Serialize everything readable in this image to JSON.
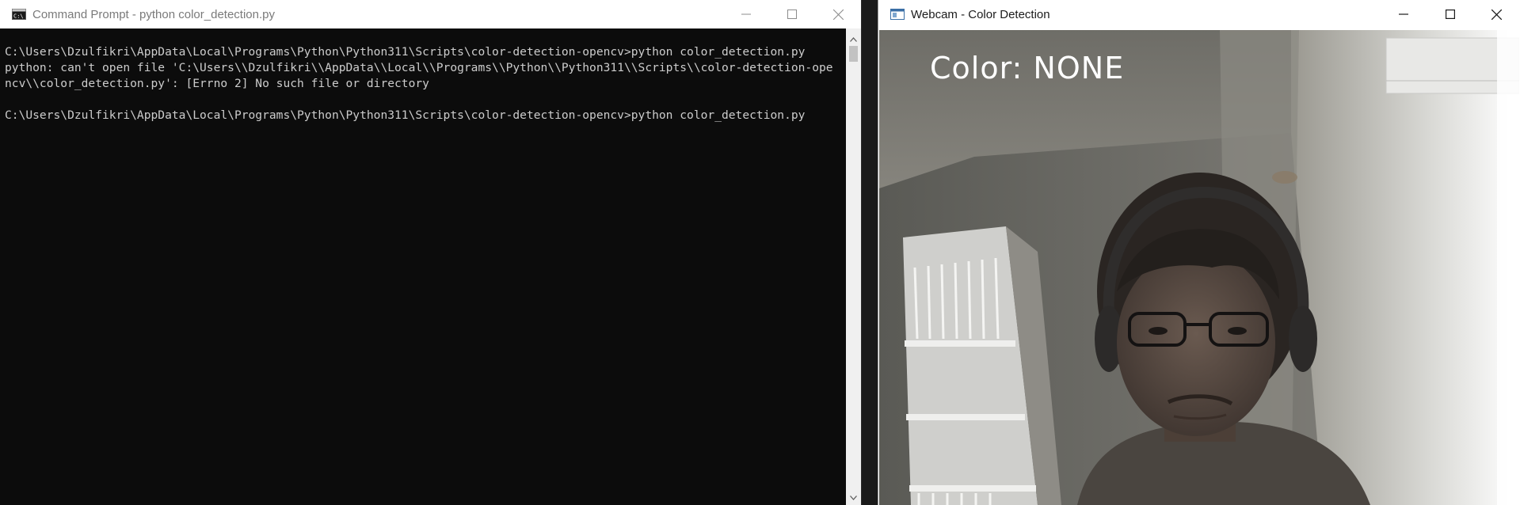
{
  "cmd": {
    "title": "Command Prompt - python  color_detection.py",
    "icon": "cmd-icon",
    "lines": [
      "C:\\Users\\Dzulfikri\\AppData\\Local\\Programs\\Python\\Python311\\Scripts\\color-detection-opencv>python color_detection.py",
      "python: can't open file 'C:\\Users\\\\Dzulfikri\\\\AppData\\\\Local\\\\Programs\\\\Python\\\\Python311\\\\Scripts\\\\color-detection-ope",
      "ncv\\\\color_detection.py': [Errno 2] No such file or directory",
      "",
      "C:\\Users\\Dzulfikri\\AppData\\Local\\Programs\\Python\\Python311\\Scripts\\color-detection-opencv>python color_detection.py"
    ]
  },
  "webcam": {
    "title": "Webcam - Color Detection",
    "icon": "webcam-window-icon",
    "overlay_text": "Color: NONE"
  },
  "window_controls": {
    "minimize": "minimize-icon",
    "maximize": "maximize-icon",
    "close": "close-icon"
  },
  "colors": {
    "terminal_bg": "#0c0c0c",
    "terminal_text": "#cccccc",
    "titlebar_bg": "#ffffff"
  }
}
